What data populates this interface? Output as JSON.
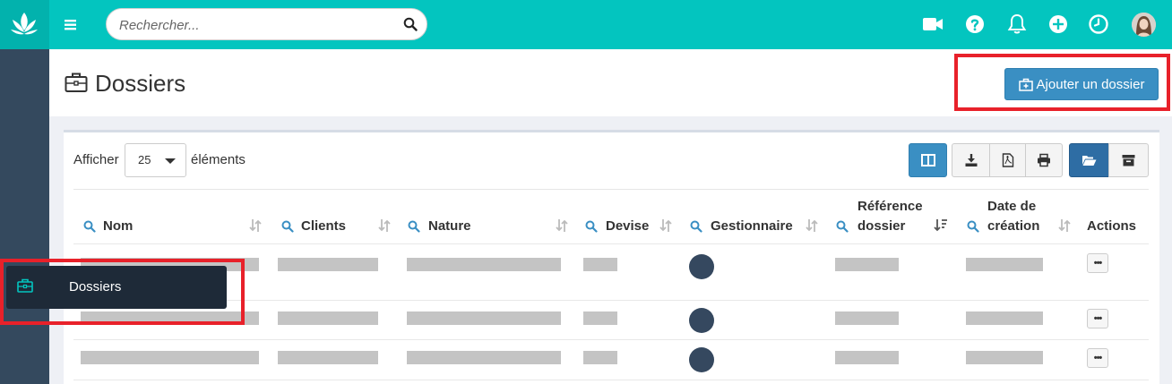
{
  "topbar": {
    "search_placeholder": "Rechercher...",
    "icons": [
      "menu-icon",
      "search-icon",
      "video-camera-icon",
      "help-icon",
      "bell-icon",
      "plus-circle-icon",
      "clock-icon"
    ],
    "accent_color": "#03c5bf"
  },
  "header": {
    "title": "Dossiers",
    "add_button": "Ajouter un dossier"
  },
  "table_controls": {
    "show_label": "Afficher",
    "page_length": "25",
    "elements_label": "éléments"
  },
  "table": {
    "columns": {
      "nom": "Nom",
      "clients": "Clients",
      "nature": "Nature",
      "devise": "Devise",
      "gestionnaire": "Gestionnaire",
      "reference_line1": "Référence",
      "reference_line2": "dossier",
      "date_line1": "Date de",
      "date_line2": "création",
      "actions": "Actions"
    },
    "action_glyph": "•••"
  },
  "sidebar_menu": {
    "item_label": "Dossiers"
  },
  "colors": {
    "sidebar": "#34495e",
    "primary_button": "#3a8fc3",
    "highlight": "#e8212a"
  }
}
